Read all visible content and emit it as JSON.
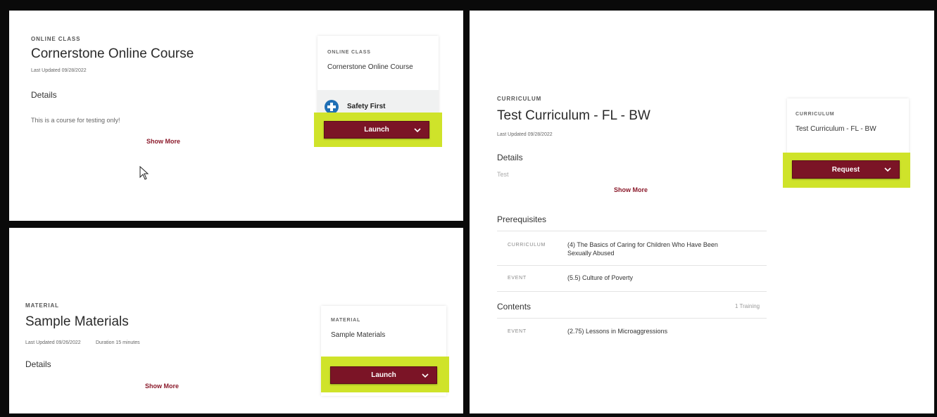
{
  "online_class": {
    "kicker": "ONLINE CLASS",
    "title": "Cornerstone Online Course",
    "last_updated": "Last Updated  09/28/2022",
    "details_label": "Details",
    "description": "This is a course for testing only!",
    "show_more": "Show More",
    "card": {
      "kicker": "ONLINE CLASS",
      "name": "Cornerstone Online Course",
      "sub_item": "Safety First",
      "sub_item_icon": "plus-circle-icon",
      "button_label": "Launch"
    }
  },
  "material": {
    "kicker": "MATERIAL",
    "title": "Sample Materials",
    "last_updated": "Last Updated  09/26/2022",
    "duration": "Duration  15 minutes",
    "details_label": "Details",
    "show_more": "Show More",
    "card": {
      "kicker": "MATERIAL",
      "name": "Sample Materials",
      "button_label": "Launch"
    }
  },
  "curriculum": {
    "kicker": "CURRICULUM",
    "title": "Test Curriculum - FL - BW",
    "last_updated": "Last Updated  09/28/2022",
    "details_label": "Details",
    "description": "Test",
    "show_more": "Show More",
    "prerequisites_label": "Prerequisites",
    "prerequisites": [
      {
        "type": "CURRICULUM",
        "title": "(4) The Basics of Caring for Children Who Have Been Sexually Abused"
      },
      {
        "type": "EVENT",
        "title": "(5.5) Culture of Poverty"
      }
    ],
    "contents_label": "Contents",
    "contents_count": "1 Training",
    "contents": [
      {
        "type": "EVENT",
        "title": "(2.75) Lessons in Microaggressions"
      }
    ],
    "card": {
      "kicker": "CURRICULUM",
      "name": "Test Curriculum - FL - BW",
      "button_label": "Request"
    }
  },
  "colors": {
    "button": "#7b1426",
    "highlight": "#cfe32a",
    "show_more": "#8b1a2b",
    "icon_blue": "#1f6fb5"
  }
}
